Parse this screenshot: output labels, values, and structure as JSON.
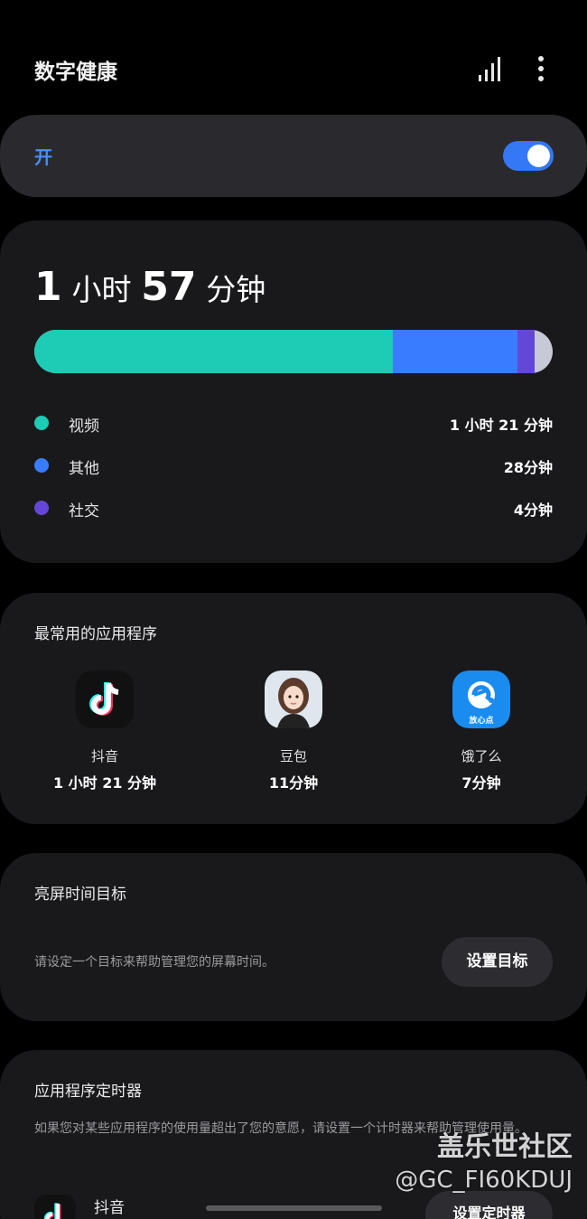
{
  "header": {
    "title": "数字健康",
    "stats_icon": "bar-chart-icon",
    "more_icon": "more-vertical-icon"
  },
  "toggle": {
    "label": "开",
    "state": "on",
    "color": "#3478f6"
  },
  "usage": {
    "total_hours": "1",
    "hours_unit": "小时",
    "total_minutes": "57",
    "minutes_unit": "分钟",
    "categories": [
      {
        "name": "视频",
        "time": "1 小时 21 分钟",
        "minutes": 81,
        "color": "#1ecbb5"
      },
      {
        "name": "其他",
        "time": "28分钟",
        "minutes": 28,
        "color": "#3a7cff"
      },
      {
        "name": "社交",
        "time": "4分钟",
        "minutes": 4,
        "color": "#6447d6"
      }
    ],
    "remainder_color": "#c7c9d6"
  },
  "top_apps": {
    "title": "最常用的应用程序",
    "apps": [
      {
        "name": "抖音",
        "time": "1 小时 21 分钟",
        "icon": "douyin-icon"
      },
      {
        "name": "豆包",
        "time": "11分钟",
        "icon": "doubao-avatar-icon"
      },
      {
        "name": "饿了么",
        "time": "7分钟",
        "icon": "eleme-icon",
        "icon_caption": "放心点"
      }
    ]
  },
  "screen_goal": {
    "title": "亮屏时间目标",
    "description": "请设定一个目标来帮助管理您的屏幕时间。",
    "button_label": "设置目标"
  },
  "app_timers": {
    "title": "应用程序定时器",
    "description": "如果您对某些应用程序的使用量超出了您的意愿，请设置一个计时器来帮助管理使用量。",
    "first_app": "抖音",
    "button_label": "设置定时器"
  },
  "watermark": {
    "line1": "盖乐世社区",
    "line2": "@GC_FI60KDUJ"
  }
}
